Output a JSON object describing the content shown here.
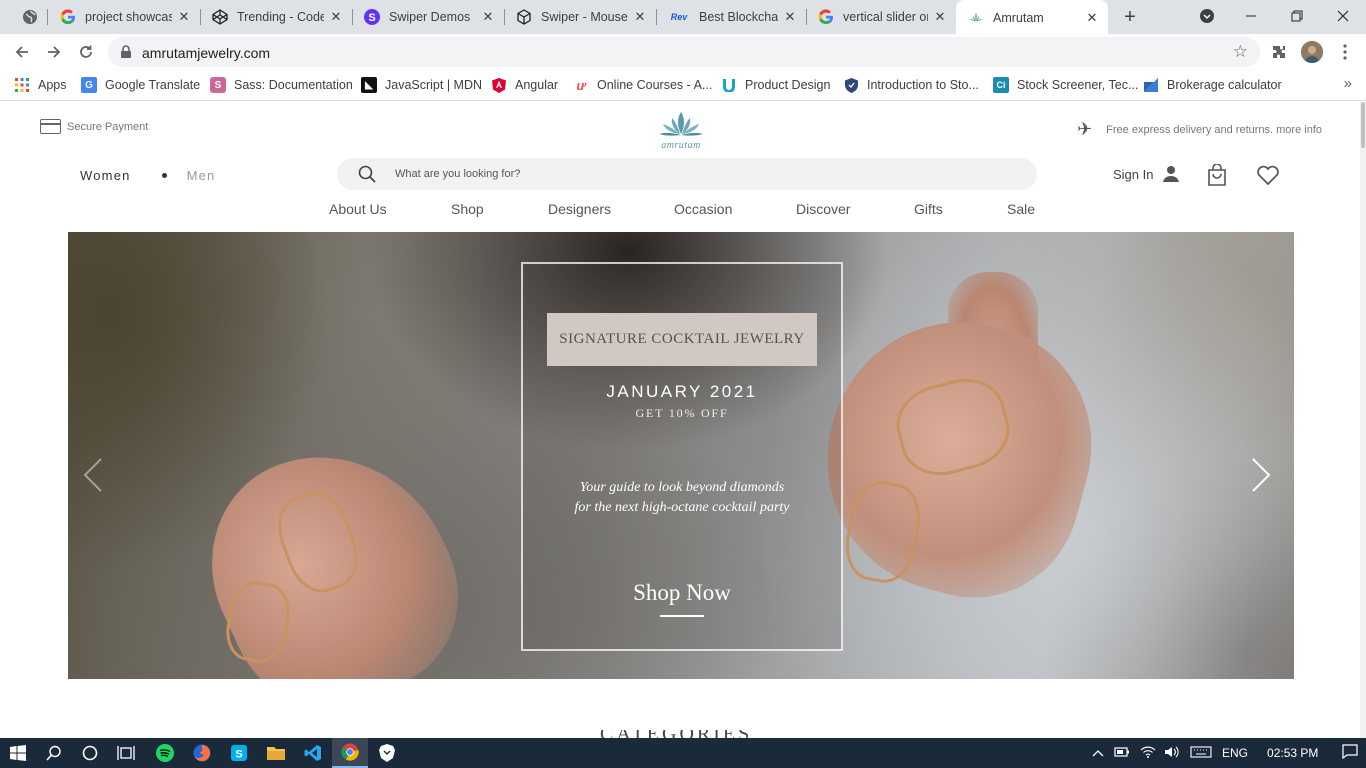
{
  "browser": {
    "tabs": [
      {
        "title": "project showcase",
        "icon": "google-icon"
      },
      {
        "title": "Trending - CodePen",
        "icon": "codepen-icon"
      },
      {
        "title": "Swiper Demos",
        "icon": "swiper-icon"
      },
      {
        "title": "Swiper - Mousewheel",
        "icon": "codesandbox-icon"
      },
      {
        "title": "Best Blockchain",
        "icon": "rev-icon",
        "icon_text": "Rev"
      },
      {
        "title": "vertical slider on",
        "icon": "google-icon"
      },
      {
        "title": "Amrutam",
        "icon": "amrutam-icon"
      }
    ],
    "active_tab_index": 6,
    "url": "amrutamjewelry.com",
    "bookmarks": [
      {
        "label": "Apps",
        "icon": "apps-grid-icon"
      },
      {
        "label": "Google Translate",
        "icon": "google-translate-icon"
      },
      {
        "label": "Sass: Documentation",
        "icon": "sass-icon"
      },
      {
        "label": "JavaScript | MDN",
        "icon": "mdn-icon"
      },
      {
        "label": "Angular",
        "icon": "angular-icon"
      },
      {
        "label": "Online Courses - A...",
        "icon": "udemy-icon"
      },
      {
        "label": "Product Design",
        "icon": "uxpin-icon"
      },
      {
        "label": "Introduction to Sto...",
        "icon": "shield-icon"
      },
      {
        "label": "Stock Screener, Tec...",
        "icon": "ci-icon",
        "icon_text": "Ci"
      },
      {
        "label": "Brokerage calculator",
        "icon": "zerodha-icon"
      }
    ]
  },
  "site": {
    "secure_payment": "Secure Payment",
    "logo_text": "amrutam",
    "delivery_text": "Free express delivery and returns. more info",
    "gender": {
      "women": "Women",
      "men": "Men"
    },
    "search_placeholder": "What are you looking for?",
    "sign_in": "Sign In",
    "nav": [
      "About Us",
      "Shop",
      "Designers",
      "Occasion",
      "Discover",
      "Gifts",
      "Sale"
    ],
    "hero": {
      "ribbon": "SIGNATURE COCKTAIL JEWELRY",
      "month": "JANUARY 2021",
      "offer": "GET 10% OFF",
      "tagline_1": "Your guide to look beyond diamonds",
      "tagline_2": "for the next high-octane cocktail party",
      "cta": "Shop Now"
    },
    "section_peek": "CATEGORIES"
  },
  "taskbar": {
    "language": "ENG",
    "time": "02:53 PM",
    "apps": [
      "windows-start-icon",
      "search-icon",
      "cortana-icon",
      "task-view-icon",
      "spotify-icon",
      "firefox-icon",
      "skype-icon",
      "file-explorer-icon",
      "vscode-icon",
      "chrome-icon",
      "brave-icon"
    ]
  },
  "colors": {
    "chrome_tabstrip": "#dee1e6",
    "taskbar": "#1b2a3a",
    "ribbon": "#d1c8c4",
    "logo_teal": "#5b9aa9"
  }
}
